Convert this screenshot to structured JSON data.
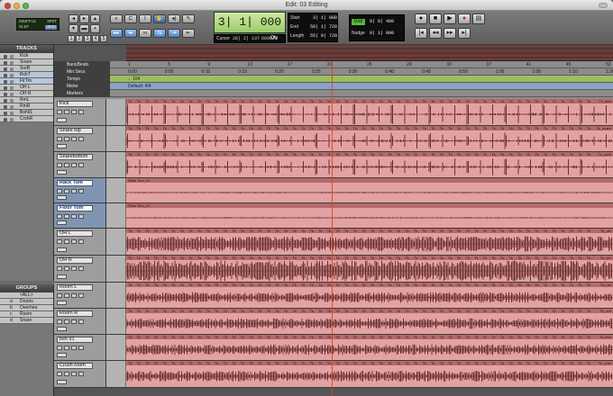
{
  "window": {
    "title": "Edit: 03 Editing"
  },
  "toolbar": {
    "mode_lcd_top": "SHUFFLE",
    "mode_lcd_top_right": "SPOT",
    "mode_lcd_bottom": "SLIP",
    "mode_lcd_bottom_right": "GRID",
    "zoom_presets": [
      "1",
      "2",
      "3",
      "4",
      "5"
    ],
    "main_counter": "3| 1| 000",
    "cursor_label": "Cursor",
    "cursor_value": "28| 2| 137",
    "sample_value": "669878",
    "qty_label": "Qty",
    "selection": {
      "start_label": "Start",
      "start_value": "3| 1| 000",
      "end_label": "End",
      "end_value": "58| 1| 728",
      "length_label": "Length",
      "length_value": "55| 0| 728"
    },
    "grid_label": "Grid",
    "grid_value": "0| 0| 480",
    "nudge_label": "Nudge",
    "nudge_value": "0| 1| 000"
  },
  "tracks_panel": {
    "title": "TRACKS",
    "items": [
      "Kick",
      "Snare",
      "SnrB",
      "RckT",
      "FlrTm",
      "OH L",
      "OH R",
      "RmL",
      "RmR",
      "Bsh91",
      "CrshR"
    ]
  },
  "groups_panel": {
    "title": "GROUPS",
    "items": [
      {
        "letter": "",
        "name": "<ALL>"
      },
      {
        "letter": "a",
        "name": "Drums"
      },
      {
        "letter": "b",
        "name": "Overhea"
      },
      {
        "letter": "c",
        "name": "Room"
      },
      {
        "letter": "d",
        "name": "Snare"
      }
    ]
  },
  "rulers": {
    "rows": [
      {
        "label": "Bars|Beats",
        "ticks": [
          "1",
          "5",
          "9",
          "13",
          "17",
          "21",
          "25",
          "29",
          "33",
          "37",
          "41",
          "45",
          "53"
        ]
      },
      {
        "label": "Min:Secs",
        "ticks": [
          "0:00",
          "0:05",
          "0:10",
          "0:15",
          "0:20",
          "0:25",
          "0:30",
          "0:40",
          "0:45",
          "0:50",
          "1:00",
          "1:05",
          "1:10",
          "1:20"
        ]
      },
      {
        "label": "Tempo",
        "ticks": [
          "♩104"
        ]
      },
      {
        "label": "Meter",
        "ticks": [
          "Default: 4/4"
        ]
      },
      {
        "label": "Markers",
        "ticks": []
      }
    ]
  },
  "tracks": [
    {
      "name": "Kick",
      "clip": "Tk",
      "right_tag": "Tk_kick",
      "density": "sparse-big",
      "highlight": false
    },
    {
      "name": "Snare top",
      "clip": "Tk",
      "right_tag": "Tk_snare",
      "density": "sparse",
      "highlight": false
    },
    {
      "name": "Snarebottom",
      "clip": "Tk",
      "right_tag": "Tk_snrb",
      "density": "sparse",
      "highlight": false
    },
    {
      "name": "Rack Tom",
      "clip": "Rack Tom_01",
      "right_tag": "",
      "density": "flat",
      "highlight": true
    },
    {
      "name": "Floor Tom",
      "clip": "Floor Tom_01",
      "right_tag": "",
      "density": "flat",
      "highlight": true
    },
    {
      "name": "OH L",
      "clip": "Tk",
      "right_tag": "Tk_ohl",
      "density": "dense",
      "highlight": false
    },
    {
      "name": "OH R",
      "clip": "Tk",
      "right_tag": "Tk_ohr",
      "density": "dense-big",
      "highlight": false
    },
    {
      "name": "Room L",
      "clip": "Tk",
      "right_tag": "Tk_rml",
      "density": "medium",
      "highlight": false
    },
    {
      "name": "Room R",
      "clip": "Tk",
      "right_tag": "Tk_rmr",
      "density": "medium",
      "highlight": false
    },
    {
      "name": "bsh 91",
      "clip": "Tk",
      "right_tag": "Tk_bsh",
      "density": "medium",
      "highlight": false
    },
    {
      "name": "Crush room",
      "clip": "Tk",
      "right_tag": "Tk_crsh",
      "density": "medium",
      "highlight": false
    }
  ]
}
